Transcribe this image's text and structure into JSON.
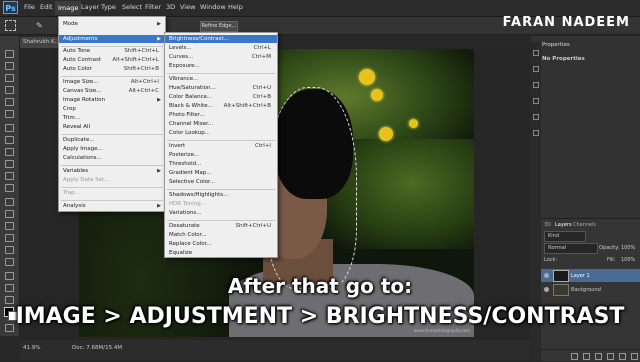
{
  "app": {
    "logo": "Ps",
    "brand_watermark": "FARAN NADEEM"
  },
  "menubar": {
    "items": [
      "File",
      "Edit",
      "Image",
      "Layer",
      "Type",
      "Select",
      "Filter",
      "3D",
      "View",
      "Window",
      "Help"
    ],
    "active": "Image"
  },
  "options_bar": {
    "refine_edge_label": "Refine Edge..."
  },
  "document": {
    "tab_title": "Shahrukh K...",
    "zoom": "41.9%",
    "doc_size": "Doc: 7.68M/15.4M",
    "photo_credit": "www.faranphotography.com"
  },
  "image_menu": {
    "items": [
      {
        "label": "Mode",
        "arrow": true
      },
      {
        "label": "Adjustments",
        "arrow": true,
        "highlighted": true
      },
      {
        "label": "Auto Tone",
        "shortcut": "Shift+Ctrl+L"
      },
      {
        "label": "Auto Contrast",
        "shortcut": "Alt+Shift+Ctrl+L"
      },
      {
        "label": "Auto Color",
        "shortcut": "Shift+Ctrl+B"
      },
      {
        "label": "Image Size...",
        "shortcut": "Alt+Ctrl+I"
      },
      {
        "label": "Canvas Size...",
        "shortcut": "Alt+Ctrl+C"
      },
      {
        "label": "Image Rotation",
        "arrow": true
      },
      {
        "label": "Crop"
      },
      {
        "label": "Trim..."
      },
      {
        "label": "Reveal All"
      },
      {
        "label": "Duplicate..."
      },
      {
        "label": "Apply Image..."
      },
      {
        "label": "Calculations..."
      },
      {
        "label": "Variables",
        "arrow": true
      },
      {
        "label": "Apply Data Set...",
        "disabled": true
      },
      {
        "label": "Trap...",
        "disabled": true
      },
      {
        "label": "Analysis",
        "arrow": true
      }
    ]
  },
  "adjustments_menu": {
    "items": [
      {
        "label": "Brightness/Contrast...",
        "highlighted": true
      },
      {
        "label": "Levels...",
        "shortcut": "Ctrl+L"
      },
      {
        "label": "Curves...",
        "shortcut": "Ctrl+M"
      },
      {
        "label": "Exposure..."
      },
      {
        "label": "Vibrance..."
      },
      {
        "label": "Hue/Saturation...",
        "shortcut": "Ctrl+U"
      },
      {
        "label": "Color Balance...",
        "shortcut": "Ctrl+B"
      },
      {
        "label": "Black & White...",
        "shortcut": "Alt+Shift+Ctrl+B"
      },
      {
        "label": "Photo Filter..."
      },
      {
        "label": "Channel Mixer..."
      },
      {
        "label": "Color Lookup..."
      },
      {
        "label": "Invert",
        "shortcut": "Ctrl+I"
      },
      {
        "label": "Posterize..."
      },
      {
        "label": "Threshold..."
      },
      {
        "label": "Gradient Map..."
      },
      {
        "label": "Selective Color..."
      },
      {
        "label": "Shadows/Highlights..."
      },
      {
        "label": "HDR Toning...",
        "disabled": true
      },
      {
        "label": "Variations..."
      },
      {
        "label": "Desaturate",
        "shortcut": "Shift+Ctrl+U"
      },
      {
        "label": "Match Color..."
      },
      {
        "label": "Replace Color..."
      },
      {
        "label": "Equalize"
      }
    ]
  },
  "properties_panel": {
    "tab": "Properties",
    "message": "No Properties"
  },
  "layers_panel": {
    "tabs": [
      "3D",
      "Layers",
      "Channels"
    ],
    "active_tab": "Layers",
    "kind_label": "Kind",
    "blend_mode": "Normal",
    "opacity_label": "Opacity:",
    "opacity_value": "100%",
    "lock_label": "Lock:",
    "fill_label": "Fill:",
    "fill_value": "100%",
    "layers": [
      {
        "name": "Layer 1",
        "selected": true
      },
      {
        "name": "Background",
        "selected": false
      }
    ]
  },
  "captions": {
    "line1": "After that go to:",
    "line2": "IMAGE > ADJUSTMENT > BRIGHTNESS/CONTRAST"
  },
  "colors": {
    "highlight": "#3a77c9",
    "menu_bg": "#efefef",
    "ui_dark": "#282828"
  }
}
